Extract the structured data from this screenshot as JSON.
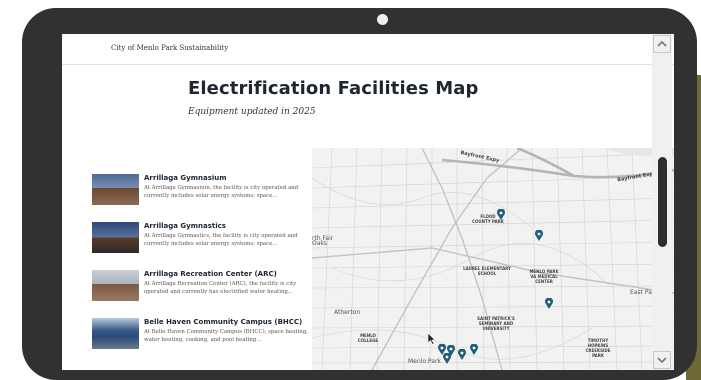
{
  "site": {
    "name": "City of Menlo Park Sustainability"
  },
  "page": {
    "title": "Electrification Facilities Map",
    "subtitle": "Equipment updated in 2025"
  },
  "facilities": [
    {
      "title": "Arrillaga Gymnasium",
      "description": "At Arrillaga Gymnasium, the facility is city operated and currently includes solar energy systems; space..."
    },
    {
      "title": "Arrillaga Gymnastics",
      "description": "At Arrillaga Gymnastics, the facility is city operated and currently includes solar energy systems; space..."
    },
    {
      "title": "Arrillaga Recreation Center (ARC)",
      "description": "At Arrillaga Recreation Center (ARC), the facility is city operated and currently has electrified water heating..."
    },
    {
      "title": "Belle Haven Community Campus (BHCC)",
      "description": "At Belle Haven Community Campus (BHCC), space heating, water heating, cooking, and pool heating..."
    }
  ],
  "map": {
    "road_labels": {
      "bayfront_1": "Bayfront Expy",
      "bayfront_2": "Bayfront Expy"
    },
    "place_labels": {
      "flood_park": "FLOOD COUNTY PARK",
      "laurel": "LAUREL ELEMENTARY SCHOOL",
      "va_center": "MENLO PARK VA MEDICAL CENTER",
      "st_patricks": "SAINT PATRICK'S SEMINARY AND UNIVERSITY",
      "menlo_college": "MENLO COLLEGE",
      "hopkins_park": "TIMOTHY HOPKINS CREEKSIDE PARK"
    },
    "city_labels": {
      "north_fair_oaks": "rth Fair Oaks",
      "atherton": "Atherton",
      "east_palo_alto": "East Palo A",
      "menlo_park": "Menlo Park"
    }
  },
  "colors": {
    "pin": "#1f5f7a",
    "title": "#1d2732",
    "device_frame": "#313131"
  }
}
